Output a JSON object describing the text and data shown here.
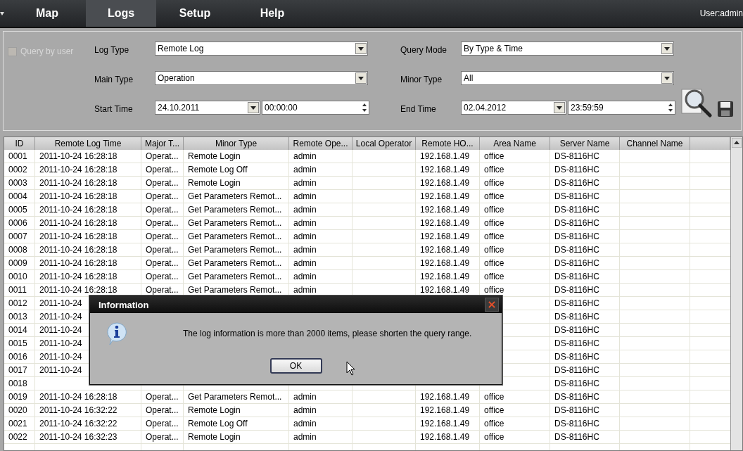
{
  "nav": {
    "tabs": [
      {
        "label": "Map",
        "selected": false
      },
      {
        "label": "Logs",
        "selected": true
      },
      {
        "label": "Setup",
        "selected": false
      },
      {
        "label": "Help",
        "selected": false
      }
    ],
    "user": "User:admin"
  },
  "filters": {
    "query_by_user": {
      "label": "Query by user",
      "checked": false,
      "disabled": true
    },
    "log_type": {
      "label": "Log Type",
      "value": "Remote Log"
    },
    "query_mode": {
      "label": "Query Mode",
      "value": "By Type & Time"
    },
    "main_type": {
      "label": "Main Type",
      "value": "Operation"
    },
    "minor_type": {
      "label": "Minor Type",
      "value": "All"
    },
    "start_time": {
      "label": "Start Time",
      "date": "24.10.2011",
      "time": "00:00:00"
    },
    "end_time": {
      "label": "End Time",
      "date": "02.04.2012",
      "time": "23:59:59"
    }
  },
  "table": {
    "columns": [
      "ID",
      "Remote Log Time",
      "Major T...",
      "Minor Type",
      "Remote Ope...",
      "Local Operator",
      "Remote HO...",
      "Area Name",
      "Server Name",
      "Channel Name"
    ],
    "rows": [
      {
        "id": "0001",
        "time": "2011-10-24 16:28:18",
        "major": "Operat...",
        "minor": "Remote Login",
        "remote_operator": "admin",
        "remote_host": "192.168.1.49",
        "area": "office",
        "server": "DS-8116HC"
      },
      {
        "id": "0002",
        "time": "2011-10-24 16:28:18",
        "major": "Operat...",
        "minor": "Remote Log Off",
        "remote_operator": "admin",
        "remote_host": "192.168.1.49",
        "area": "office",
        "server": "DS-8116HC"
      },
      {
        "id": "0003",
        "time": "2011-10-24 16:28:18",
        "major": "Operat...",
        "minor": "Remote Login",
        "remote_operator": "admin",
        "remote_host": "192.168.1.49",
        "area": "office",
        "server": "DS-8116HC"
      },
      {
        "id": "0004",
        "time": "2011-10-24 16:28:18",
        "major": "Operat...",
        "minor": "Get Parameters Remot...",
        "remote_operator": "admin",
        "remote_host": "192.168.1.49",
        "area": "office",
        "server": "DS-8116HC"
      },
      {
        "id": "0005",
        "time": "2011-10-24 16:28:18",
        "major": "Operat...",
        "minor": "Get Parameters Remot...",
        "remote_operator": "admin",
        "remote_host": "192.168.1.49",
        "area": "office",
        "server": "DS-8116HC"
      },
      {
        "id": "0006",
        "time": "2011-10-24 16:28:18",
        "major": "Operat...",
        "minor": "Get Parameters Remot...",
        "remote_operator": "admin",
        "remote_host": "192.168.1.49",
        "area": "office",
        "server": "DS-8116HC"
      },
      {
        "id": "0007",
        "time": "2011-10-24 16:28:18",
        "major": "Operat...",
        "minor": "Get Parameters Remot...",
        "remote_operator": "admin",
        "remote_host": "192.168.1.49",
        "area": "office",
        "server": "DS-8116HC"
      },
      {
        "id": "0008",
        "time": "2011-10-24 16:28:18",
        "major": "Operat...",
        "minor": "Get Parameters Remot...",
        "remote_operator": "admin",
        "remote_host": "192.168.1.49",
        "area": "office",
        "server": "DS-8116HC"
      },
      {
        "id": "0009",
        "time": "2011-10-24 16:28:18",
        "major": "Operat...",
        "minor": "Get Parameters Remot...",
        "remote_operator": "admin",
        "remote_host": "192.168.1.49",
        "area": "office",
        "server": "DS-8116HC"
      },
      {
        "id": "0010",
        "time": "2011-10-24 16:28:18",
        "major": "Operat...",
        "minor": "Get Parameters Remot...",
        "remote_operator": "admin",
        "remote_host": "192.168.1.49",
        "area": "office",
        "server": "DS-8116HC"
      },
      {
        "id": "0011",
        "time": "2011-10-24 16:28:18",
        "major": "Operat...",
        "minor": "Get Parameters Remot...",
        "remote_operator": "admin",
        "remote_host": "192.168.1.49",
        "area": "office",
        "server": "DS-8116HC"
      },
      {
        "id": "0012",
        "time": "2011-10-24",
        "server": "DS-8116HC"
      },
      {
        "id": "0013",
        "time": "2011-10-24",
        "server": "DS-8116HC"
      },
      {
        "id": "0014",
        "time": "2011-10-24",
        "server": "DS-8116HC"
      },
      {
        "id": "0015",
        "time": "2011-10-24",
        "server": "DS-8116HC"
      },
      {
        "id": "0016",
        "time": "2011-10-24",
        "server": "DS-8116HC"
      },
      {
        "id": "0017",
        "time": "2011-10-24",
        "server": "DS-8116HC"
      },
      {
        "id": "0018",
        "server": "DS-8116HC"
      },
      {
        "id": "0019",
        "time": "2011-10-24 16:28:18",
        "major": "Operat...",
        "minor": "Get Parameters Remot...",
        "remote_operator": "admin",
        "remote_host": "192.168.1.49",
        "area": "office",
        "server": "DS-8116HC"
      },
      {
        "id": "0020",
        "time": "2011-10-24 16:32:22",
        "major": "Operat...",
        "minor": "Remote Login",
        "remote_operator": "admin",
        "remote_host": "192.168.1.49",
        "area": "office",
        "server": "DS-8116HC"
      },
      {
        "id": "0021",
        "time": "2011-10-24 16:32:22",
        "major": "Operat...",
        "minor": "Remote Log Off",
        "remote_operator": "admin",
        "remote_host": "192.168.1.49",
        "area": "office",
        "server": "DS-8116HC"
      },
      {
        "id": "0022",
        "time": "2011-10-24 16:32:23",
        "major": "Operat...",
        "minor": "Remote Login",
        "remote_operator": "admin",
        "remote_host": "192.168.1.49",
        "area": "office",
        "server": "DS-8116HC"
      }
    ]
  },
  "dialog": {
    "title": "Information",
    "close": "×",
    "message": "The log information is more than 2000 items, please shorten the query range.",
    "button": "OK"
  }
}
